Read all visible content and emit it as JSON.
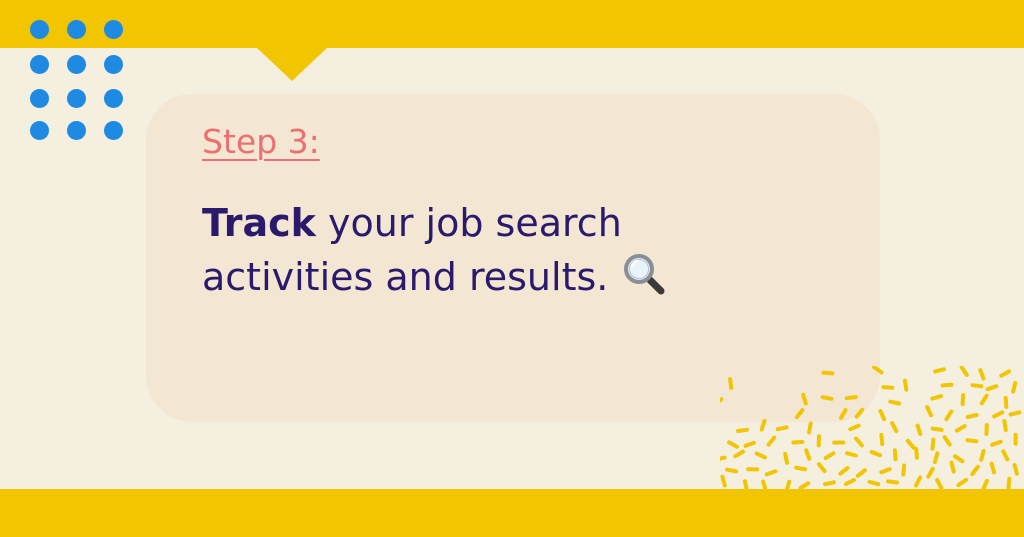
{
  "colors": {
    "band": "#f1c500",
    "background": "#f5efe0",
    "card": "#f3e6d3",
    "dots": "#1f8ae2",
    "step_label": "#ec6f72",
    "headline": "#2b1a6b",
    "confetti": "#f1c500"
  },
  "icons": {
    "magnifier": "magnifying-glass-icon"
  },
  "card": {
    "step_label": "Step 3:",
    "headline_bold": "Track",
    "headline_rest": " your job search activities and results."
  }
}
